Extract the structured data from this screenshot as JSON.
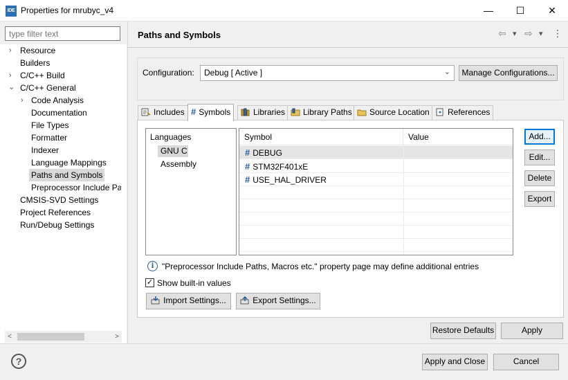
{
  "window": {
    "icon_text": "IDE",
    "title": "Properties for mrubyc_v4",
    "minimize_glyph": "—",
    "maximize_glyph": "☐",
    "close_glyph": "✕"
  },
  "sidebar": {
    "filter_placeholder": "type filter text",
    "items": [
      {
        "label": "Resource",
        "twisty": "›"
      },
      {
        "label": "Builders",
        "twisty": ""
      },
      {
        "label": "C/C++ Build",
        "twisty": "›"
      },
      {
        "label": "C/C++ General",
        "twisty": "⌄"
      },
      {
        "label": "Code Analysis",
        "twisty": "›"
      },
      {
        "label": "Documentation",
        "twisty": ""
      },
      {
        "label": "File Types",
        "twisty": ""
      },
      {
        "label": "Formatter",
        "twisty": ""
      },
      {
        "label": "Indexer",
        "twisty": ""
      },
      {
        "label": "Language Mappings",
        "twisty": ""
      },
      {
        "label": "Paths and Symbols",
        "twisty": ""
      },
      {
        "label": "Preprocessor Include Pat",
        "twisty": ""
      },
      {
        "label": "CMSIS-SVD Settings",
        "twisty": ""
      },
      {
        "label": "Project References",
        "twisty": ""
      },
      {
        "label": "Run/Debug Settings",
        "twisty": ""
      }
    ],
    "selected": "Paths and Symbols",
    "scroll_left": "<",
    "scroll_right": ">"
  },
  "page": {
    "title": "Paths and Symbols",
    "nav_back": "⇦",
    "nav_forward": "⇨",
    "nav_dropdown": "▾",
    "menu": "⋮"
  },
  "configuration": {
    "label": "Configuration:",
    "value": "Debug  [ Active ]",
    "dropdown_glyph": "⌄",
    "manage_button": "Manage Configurations..."
  },
  "tabs": [
    {
      "label": "Includes",
      "icon": "includes-icon"
    },
    {
      "label": "Symbols",
      "icon": "hash-icon"
    },
    {
      "label": "Libraries",
      "icon": "libraries-icon"
    },
    {
      "label": "Library Paths",
      "icon": "library-paths-icon"
    },
    {
      "label": "Source Location",
      "icon": "folder-icon"
    },
    {
      "label": "References",
      "icon": "references-icon"
    }
  ],
  "active_tab": "Symbols",
  "languages": {
    "header": "Languages",
    "items": [
      "GNU C",
      "Assembly"
    ],
    "selected": "GNU C"
  },
  "symbols_table": {
    "columns": [
      "Symbol",
      "Value"
    ],
    "hash_glyph": "#",
    "rows": [
      {
        "symbol": "DEBUG",
        "value": ""
      },
      {
        "symbol": "STM32F401xE",
        "value": ""
      },
      {
        "symbol": "USE_HAL_DRIVER",
        "value": ""
      }
    ],
    "selected_row": 0
  },
  "side_buttons": {
    "add": "Add...",
    "edit": "Edit...",
    "delete": "Delete",
    "export": "Export"
  },
  "info": {
    "icon_glyph": "i",
    "text": "\"Preprocessor Include Paths, Macros etc.\" property page may define additional entries"
  },
  "show_builtin": {
    "label": "Show built-in values",
    "checked": true,
    "check_glyph": "✓"
  },
  "settings_buttons": {
    "import": "Import Settings...",
    "export": "Export Settings..."
  },
  "footer": {
    "restore_defaults": "Restore Defaults",
    "apply": "Apply",
    "apply_and_close": "Apply and Close",
    "cancel": "Cancel",
    "help_glyph": "?"
  },
  "colors": {
    "accent": "#0078d7",
    "hash": "#2a5a9e",
    "selection": "#d9d9d9"
  }
}
